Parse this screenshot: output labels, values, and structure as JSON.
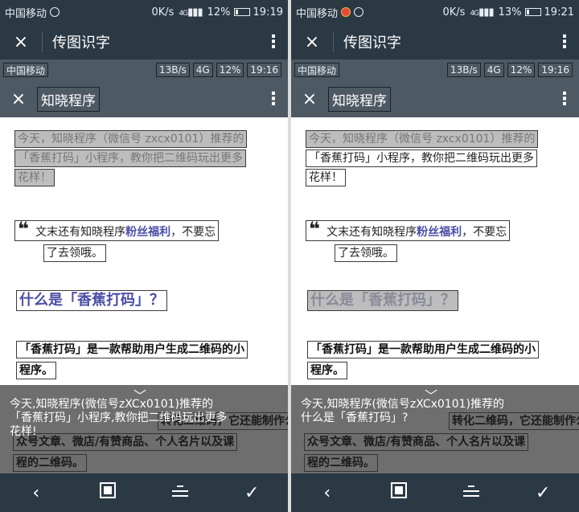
{
  "left": {
    "status": {
      "carrier": "中国移动",
      "speed": "0K/s",
      "network": "4G",
      "battery": "12%",
      "time": "19:19"
    },
    "appbar": {
      "title": "传图识字"
    },
    "inner_status": {
      "carrier": "中国移动",
      "speed": "13B/s",
      "network": "4G",
      "battery": "12%",
      "time": "19:16"
    },
    "inner_appbar": {
      "title": "知晓程序"
    },
    "article": {
      "line1": "今天，知晓程序（微信号 zxcx0101）推荐的",
      "line2": "「香蕉打码」小程序，教你把二维码玩出更多",
      "line3": "花样！",
      "quote_pre": "文末还有知晓程序",
      "quote_hl": "粉丝福利",
      "quote_post": "，不要忘",
      "quote_line2": "了去领哦。",
      "heading": "什么是「香蕉打码」？",
      "body_line1": "「香蕉打码」是一款帮助用户生成二维码的小",
      "body_line2": "程序。"
    },
    "result": {
      "text": "今天,知晓程序(微信号zXCx0101)推荐的\n「香蕉打码」小程序,教你把二维码玩出更多\n花样!",
      "bg1": "转化二维码，它还能制作公",
      "bg2": "众号文章、微店/有赞商品、个人名片以及课",
      "bg3": "程的二维码。"
    }
  },
  "right": {
    "status": {
      "carrier": "中国移动",
      "speed": "0K/s",
      "network": "4G",
      "battery": "13%",
      "time": "19:21"
    },
    "appbar": {
      "title": "传图识字"
    },
    "inner_status": {
      "carrier": "中国移动",
      "speed": "13B/s",
      "network": "4G",
      "battery": "12%",
      "time": "19:16"
    },
    "inner_appbar": {
      "title": "知晓程序"
    },
    "article": {
      "line1": "今天，知晓程序（微信号 zxcx0101）推荐的",
      "line2": "「香蕉打码」小程序，教你把二维码玩出更多",
      "line3": "花样！",
      "quote_pre": "文末还有知晓程序",
      "quote_hl": "粉丝福利",
      "quote_post": "，不要忘",
      "quote_line2": "了去领哦。",
      "heading": "什么是「香蕉打码」？",
      "body_line1": "「香蕉打码」是一款帮助用户生成二维码的小",
      "body_line2": "程序。"
    },
    "result": {
      "text": "今天,知晓程序(微信号zXCx0101)推荐的\n什么是「香蕉打码」?",
      "bg1": "转化二维码，它还能制作公",
      "bg2": "众号文章、微店/有赞商品、个人名片以及课",
      "bg3": "程的二维码。"
    }
  },
  "icons": {
    "close": "×",
    "more": "⋮",
    "back": "‹",
    "confirm": "✓",
    "chevron": "﹀",
    "quote": "❝"
  },
  "colors": {
    "bar": "#2b3945",
    "inner_bar": "#4d5963",
    "highlight": "#4a4ea6",
    "selected_grey": "#bdbdbd"
  }
}
